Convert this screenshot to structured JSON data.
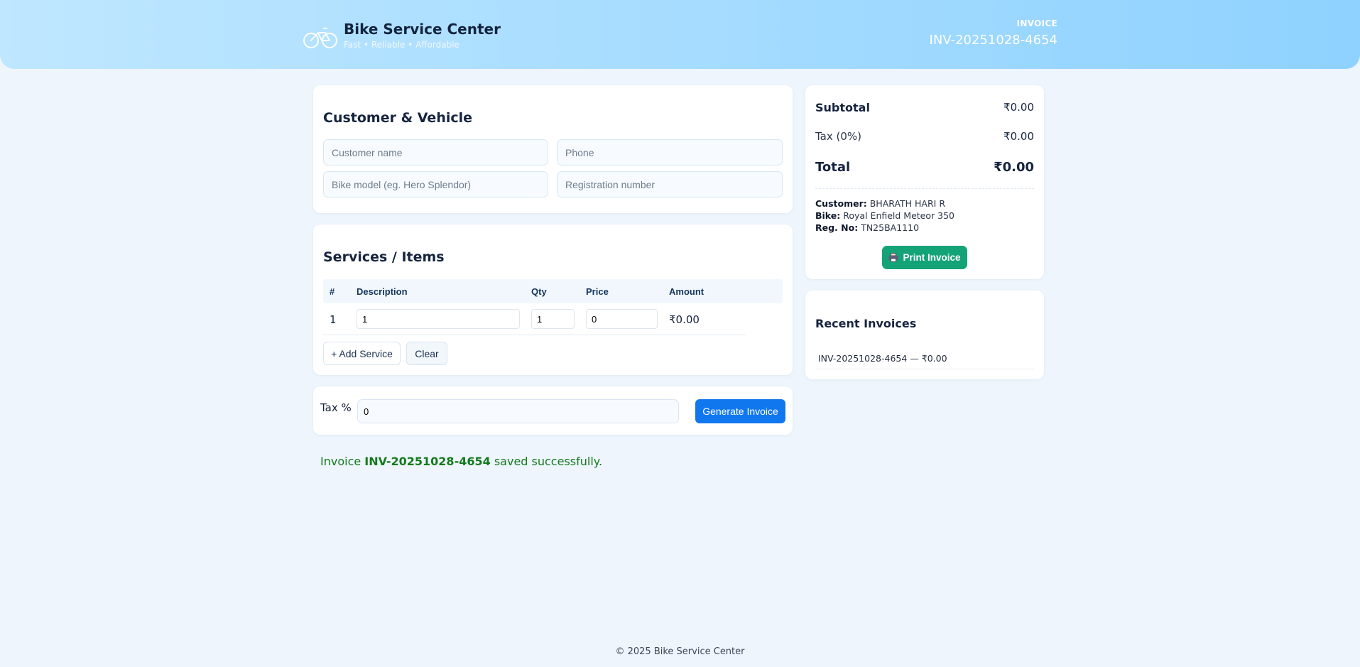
{
  "header": {
    "brand_title": "Bike Service Center",
    "brand_tagline": "Fast • Reliable • Affordable",
    "invoice_label": "INVOICE",
    "invoice_number": "INV-20251028-4654"
  },
  "customer_card": {
    "title": "Customer & Vehicle",
    "customer_name": {
      "value": "",
      "placeholder": "Customer name"
    },
    "phone": {
      "value": "",
      "placeholder": "Phone"
    },
    "bike_model": {
      "value": "",
      "placeholder": "Bike model (eg. Hero Splendor)"
    },
    "registration": {
      "value": "",
      "placeholder": "Registration number"
    }
  },
  "services_card": {
    "title": "Services / Items",
    "columns": [
      "#",
      "Description",
      "Qty",
      "Price",
      "Amount"
    ],
    "rows": [
      {
        "index": "1",
        "description": "1",
        "qty": "1",
        "price": "0",
        "amount": "₹0.00"
      }
    ],
    "add_button": "+ Add Service",
    "clear_button": "Clear"
  },
  "tax_card": {
    "label": "Tax %",
    "value": "0",
    "generate_button": "Generate Invoice"
  },
  "status": {
    "prefix": "Invoice",
    "invoice_number": "INV-20251028-4654",
    "suffix": "saved successfully."
  },
  "summary": {
    "subtotal_label": "Subtotal",
    "subtotal_value": "₹0.00",
    "tax_label": "Tax (0%)",
    "tax_value": "₹0.00",
    "total_label": "Total",
    "total_value": "₹0.00",
    "customer_label": "Customer:",
    "customer_value": "BHARATH HARI R",
    "bike_label": "Bike:",
    "bike_value": "Royal Enfield Meteor 350",
    "reg_label": "Reg. No:",
    "reg_value": "TN25BA1110",
    "print_button": "Print Invoice"
  },
  "recent": {
    "title": "Recent Invoices",
    "items": [
      "INV-20251028-4654 — ₹0.00"
    ]
  },
  "footer": {
    "text": "© 2025 Bike Service Center"
  },
  "colors": {
    "accent": "#1177ee",
    "print_button": "#13a377",
    "success_text": "#137a1c",
    "header_gradient_start": "#bfe7ff",
    "header_gradient_end": "#8fd2ff"
  },
  "icons": [
    "bike-logo-icon",
    "printer-icon"
  ]
}
